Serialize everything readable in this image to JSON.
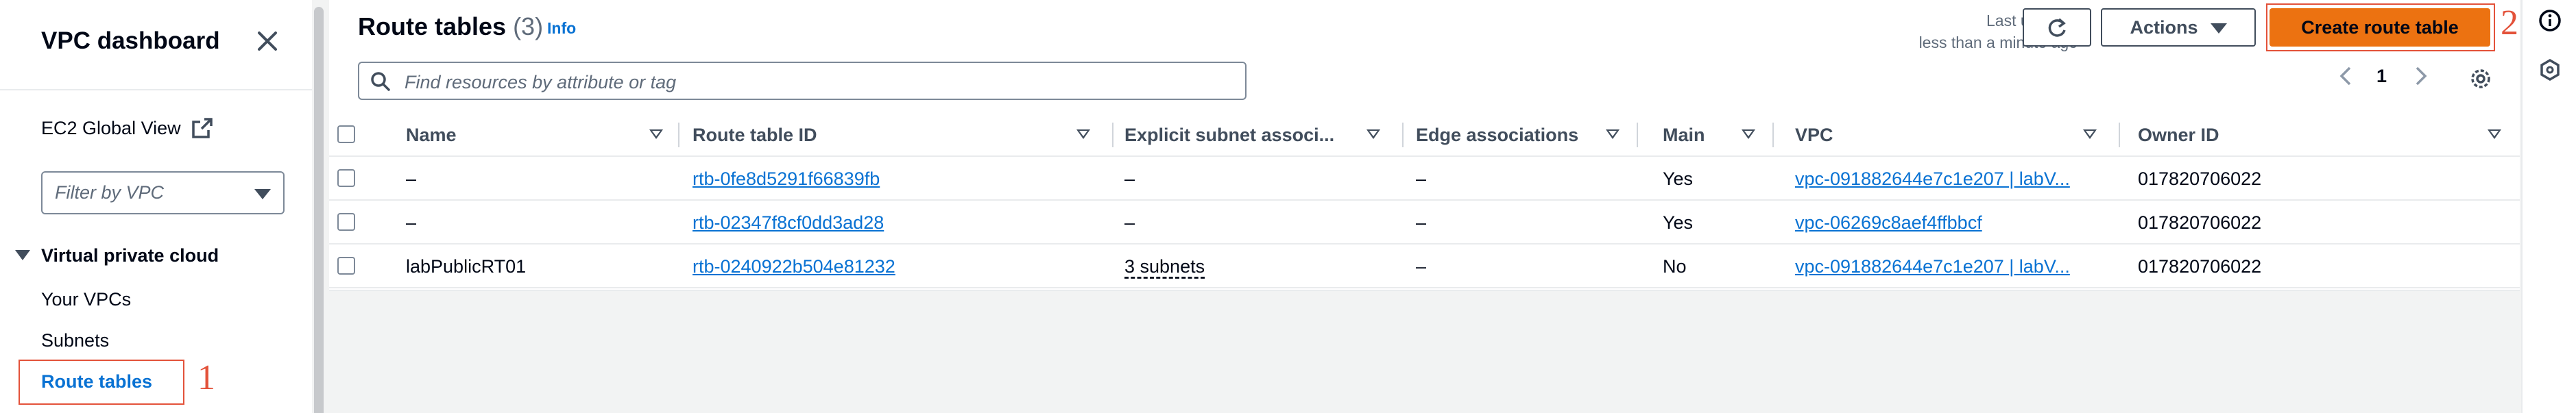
{
  "sidebar": {
    "title": "VPC dashboard",
    "global_view": "EC2 Global View",
    "filter_placeholder": "Filter by VPC",
    "section": "Virtual private cloud",
    "items": [
      "Your VPCs",
      "Subnets",
      "Route tables"
    ],
    "active_item": "Route tables",
    "annotation_number": "1"
  },
  "header": {
    "title": "Route tables",
    "count": "(3)",
    "info": "Info",
    "last_updated_line1": "Last updated",
    "last_updated_line2": "less than a minute ago",
    "actions_label": "Actions",
    "create_label": "Create route table",
    "annotation_number": "2"
  },
  "search": {
    "placeholder": "Find resources by attribute or tag"
  },
  "pagination": {
    "current_page": "1"
  },
  "table": {
    "columns": [
      "Name",
      "Route table ID",
      "Explicit subnet associ...",
      "Edge associations",
      "Main",
      "VPC",
      "Owner ID"
    ],
    "rows": [
      {
        "name": "–",
        "id": "rtb-0fe8d5291f66839fb",
        "subnets": "–",
        "edge": "–",
        "main": "Yes",
        "vpc": "vpc-091882644e7c1e207 | labV...",
        "owner": "017820706022"
      },
      {
        "name": "–",
        "id": "rtb-02347f8cf0dd3ad28",
        "subnets": "–",
        "edge": "–",
        "main": "Yes",
        "vpc": "vpc-06269c8aef4ffbbcf",
        "owner": "017820706022"
      },
      {
        "name": "labPublicRT01",
        "id": "rtb-0240922b504e81232",
        "subnets": "3 subnets",
        "edge": "–",
        "main": "No",
        "vpc": "vpc-091882644e7c1e207 | labV...",
        "owner": "017820706022"
      }
    ]
  },
  "colors": {
    "primary_button": "#ec7211",
    "link": "#0972d3",
    "annotation": "#e3523a"
  },
  "icons": [
    "close-icon",
    "external-link-icon",
    "search-icon",
    "refresh-icon",
    "settings-icon",
    "info-circle-icon",
    "security-icon"
  ]
}
